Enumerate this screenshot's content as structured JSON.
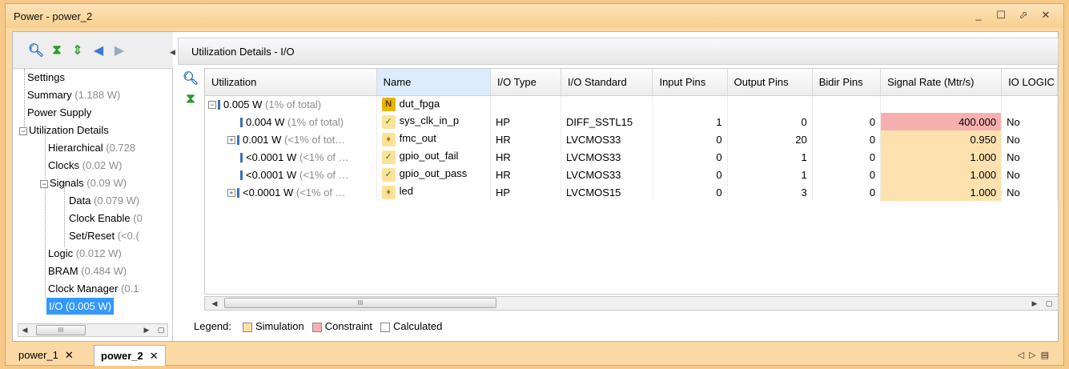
{
  "window": {
    "title": "Power - power_2"
  },
  "nav": {
    "items": [
      {
        "label": "Settings",
        "value": ""
      },
      {
        "label": "Summary",
        "value": "(1.188 W)"
      },
      {
        "label": "Power Supply",
        "value": ""
      },
      {
        "label": "Utilization Details",
        "value": ""
      },
      {
        "label": "Hierarchical",
        "value": "(0.728"
      },
      {
        "label": "Clocks",
        "value": "(0.02 W)"
      },
      {
        "label": "Signals",
        "value": "(0.09 W)"
      },
      {
        "label": "Data",
        "value": "(0.079 W)"
      },
      {
        "label": "Clock Enable",
        "value": "(0"
      },
      {
        "label": "Set/Reset",
        "value": "(<0.("
      },
      {
        "label": "Logic",
        "value": "(0.012 W)"
      },
      {
        "label": "BRAM",
        "value": "(0.484 W)"
      },
      {
        "label": "Clock Manager",
        "value": "(0.1"
      },
      {
        "label": "I/O",
        "value": "(0.005 W)"
      }
    ]
  },
  "panel": {
    "title": "Utilization Details - I/O"
  },
  "table": {
    "headers": [
      "Utilization",
      "Name",
      "I/O Type",
      "I/O Standard",
      "Input Pins",
      "Output Pins",
      "Bidir Pins",
      "Signal Rate (Mtr/s)",
      "IO LOGIC"
    ],
    "rows": [
      {
        "util": "0.005 W",
        "util_note": "(1% of total)",
        "name": "dut_fpga",
        "icon": "N",
        "io_type": "",
        "io_std": "",
        "in": "",
        "out": "",
        "bidir": "",
        "rate": "",
        "logic": ""
      },
      {
        "util": "0.004 W",
        "util_note": "(1% of total)",
        "name": "sys_clk_in_p",
        "icon": "✓",
        "io_type": "HP",
        "io_std": "DIFF_SSTL15",
        "in": "1",
        "out": "0",
        "bidir": "0",
        "rate": "400.000",
        "logic": "No"
      },
      {
        "util": "0.001 W",
        "util_note": "(<1% of tot…",
        "name": "fmc_out",
        "icon": "♦",
        "io_type": "HR",
        "io_std": "LVCMOS33",
        "in": "0",
        "out": "20",
        "bidir": "0",
        "rate": "0.950",
        "logic": "No"
      },
      {
        "util": "<0.0001 W",
        "util_note": "(<1% of …",
        "name": "gpio_out_fail",
        "icon": "✓",
        "io_type": "HR",
        "io_std": "LVCMOS33",
        "in": "0",
        "out": "1",
        "bidir": "0",
        "rate": "1.000",
        "logic": "No"
      },
      {
        "util": "<0.0001 W",
        "util_note": "(<1% of …",
        "name": "gpio_out_pass",
        "icon": "✓",
        "io_type": "HR",
        "io_std": "LVCMOS33",
        "in": "0",
        "out": "1",
        "bidir": "0",
        "rate": "1.000",
        "logic": "No"
      },
      {
        "util": "<0.0001 W",
        "util_note": "(<1% of …",
        "name": "led",
        "icon": "♦",
        "io_type": "HP",
        "io_std": "LVCMOS15",
        "in": "0",
        "out": "3",
        "bidir": "0",
        "rate": "1.000",
        "logic": "No"
      }
    ]
  },
  "legend": {
    "label": "Legend:",
    "simulation": "Simulation",
    "constraint": "Constraint",
    "calculated": "Calculated"
  },
  "tabs": [
    {
      "label": "power_1"
    },
    {
      "label": "power_2"
    }
  ],
  "colors": {
    "simulation": "#fde2b0",
    "constraint": "#f7b0b0",
    "selection": "#3399ff",
    "frame": "#fbd9a4"
  }
}
